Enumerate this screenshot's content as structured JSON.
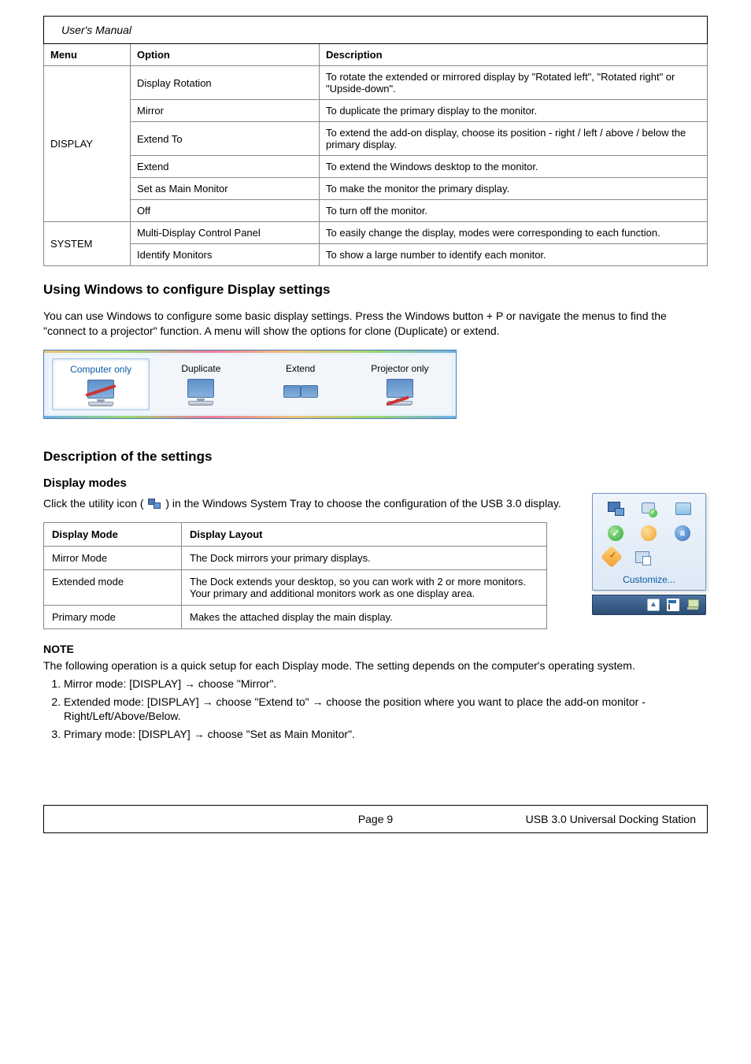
{
  "header": {
    "label": "User's Manual"
  },
  "opts_table": {
    "headers": [
      "Menu",
      "Option",
      "Description"
    ],
    "groups": [
      {
        "menu": "DISPLAY",
        "rows": [
          {
            "opt": "Display Rotation",
            "desc": "To rotate the extended or mirrored display by \"Rotated left\", \"Rotated right\" or \"Upside-down\"."
          },
          {
            "opt": "Mirror",
            "desc": "To duplicate the primary display to the monitor."
          },
          {
            "opt": "Extend To",
            "desc": "To extend the add-on display, choose its position - right / left / above / below the primary display."
          },
          {
            "opt": "Extend",
            "desc": "To extend the Windows desktop to the monitor."
          },
          {
            "opt": "Set as Main Monitor",
            "desc": "To make the monitor the primary display."
          },
          {
            "opt": "Off",
            "desc": "To turn off the monitor."
          }
        ]
      },
      {
        "menu": "SYSTEM",
        "rows": [
          {
            "opt": "Multi-Display Control Panel",
            "desc": "To easily change the display, modes were corresponding to each function."
          },
          {
            "opt": "Identify Monitors",
            "desc": "To show a large number to identify each monitor."
          }
        ]
      }
    ]
  },
  "section1": {
    "title": "Using Windows to configure Display settings",
    "p1": "You can use Windows to configure some basic display settings. Press the Windows button + P or navigate the menus to find the \"connect to a projector\" function. A menu will show the options for clone (Duplicate) or extend."
  },
  "proj_panel": {
    "items": [
      {
        "label": "Computer only",
        "kind": "computer-only",
        "selected": true
      },
      {
        "label": "Duplicate",
        "kind": "duplicate",
        "selected": false
      },
      {
        "label": "Extend",
        "kind": "extend",
        "selected": false
      },
      {
        "label": "Projector only",
        "kind": "projector-only",
        "selected": false
      }
    ]
  },
  "section2": {
    "title": "Description of the settings",
    "heading": "Display modes",
    "lead_a": "Click the utility icon (",
    "lead_b": ") in the Windows System Tray to choose the configuration of the USB 3.0 display."
  },
  "modes_table": {
    "headers": [
      "Display Mode",
      "Display Layout"
    ],
    "rows": [
      {
        "mode": "Mirror Mode",
        "layout": "The Dock mirrors your primary displays."
      },
      {
        "mode": "Extended mode",
        "layout": "The Dock extends your desktop, so you can work with 2 or more monitors. Your primary and additional monitors work as one display area."
      },
      {
        "mode": "Primary mode",
        "layout": "Makes the attached display the main display."
      }
    ]
  },
  "note": {
    "label": "NOTE",
    "intro": "The following operation is a quick setup for each Display mode. The setting depends on the computer's operating system.",
    "items": [
      "Mirror mode: [DISPLAY] → choose \"Mirror\".",
      "Extended mode: [DISPLAY] → choose \"Extend to\" → choose the position where you want to place the add-on monitor - Right/Left/Above/Below.",
      "Primary mode: [DISPLAY] → choose \"Set as Main Monitor\"."
    ]
  },
  "tray": {
    "customize": "Customize..."
  },
  "footer": {
    "left": "",
    "center": "Page 9",
    "right": "USB 3.0 Universal Docking Station"
  }
}
